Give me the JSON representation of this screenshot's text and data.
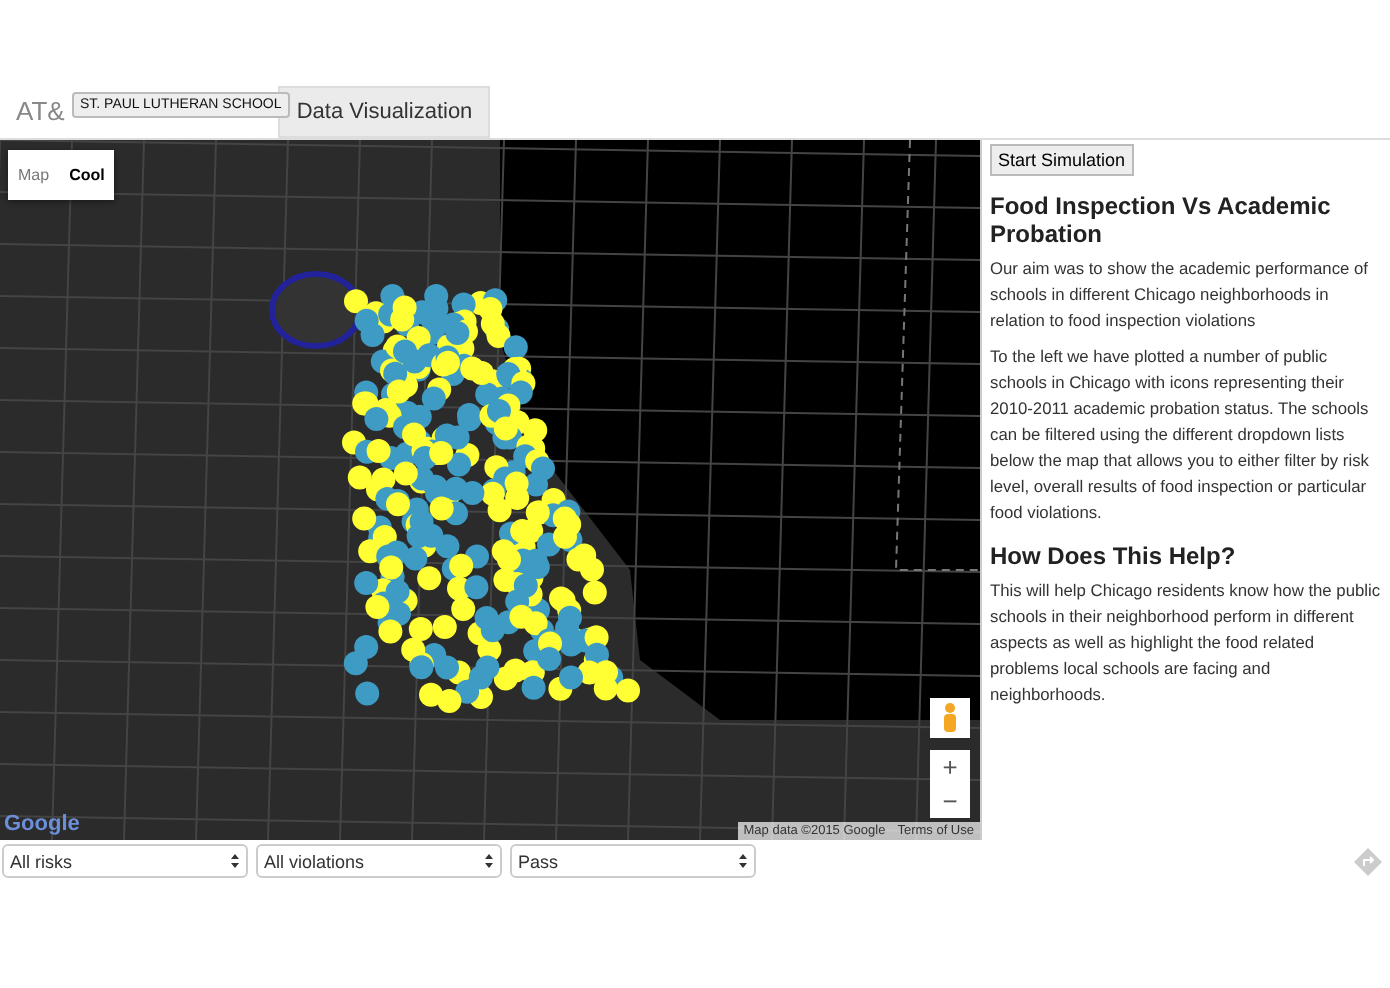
{
  "header": {
    "title": "AT&",
    "tooltip": "ST. PAUL LUTHERAN SCHOOL",
    "tabs": [
      {
        "label": "Data Visualization",
        "selected": true
      }
    ]
  },
  "map": {
    "types": [
      {
        "label": "Map",
        "selected": false
      },
      {
        "label": "Cool",
        "selected": true
      }
    ],
    "zoom_in": "+",
    "zoom_out": "−",
    "logo": "Google",
    "attribution": "Map data ©2015 Google",
    "terms": "Terms of Use"
  },
  "filters": [
    {
      "value": "All risks"
    },
    {
      "value": "All violations"
    },
    {
      "value": "Pass"
    }
  ],
  "panel": {
    "button": "Start Simulation",
    "sections": [
      {
        "heading": "Food Inspection Vs Academic Probation",
        "paragraphs": [
          "Our aim was to show the academic performance of schools in different Chicago neighborhoods in relation to food inspection violations",
          "To the left we have plotted a number of public schools in Chicago with icons representing their 2010-2011 academic probation status. The schools can be filtered using the different dropdown lists below the map that allows you to either filter by risk level, overall results of food inspection or particular food violations."
        ]
      },
      {
        "heading": "How Does This Help?",
        "paragraphs": [
          "This will help Chicago residents know how the public schools in their neighborhood perform in different aspects as well as highlight the food related problems local schools are facing and neighborhoods."
        ]
      }
    ]
  }
}
